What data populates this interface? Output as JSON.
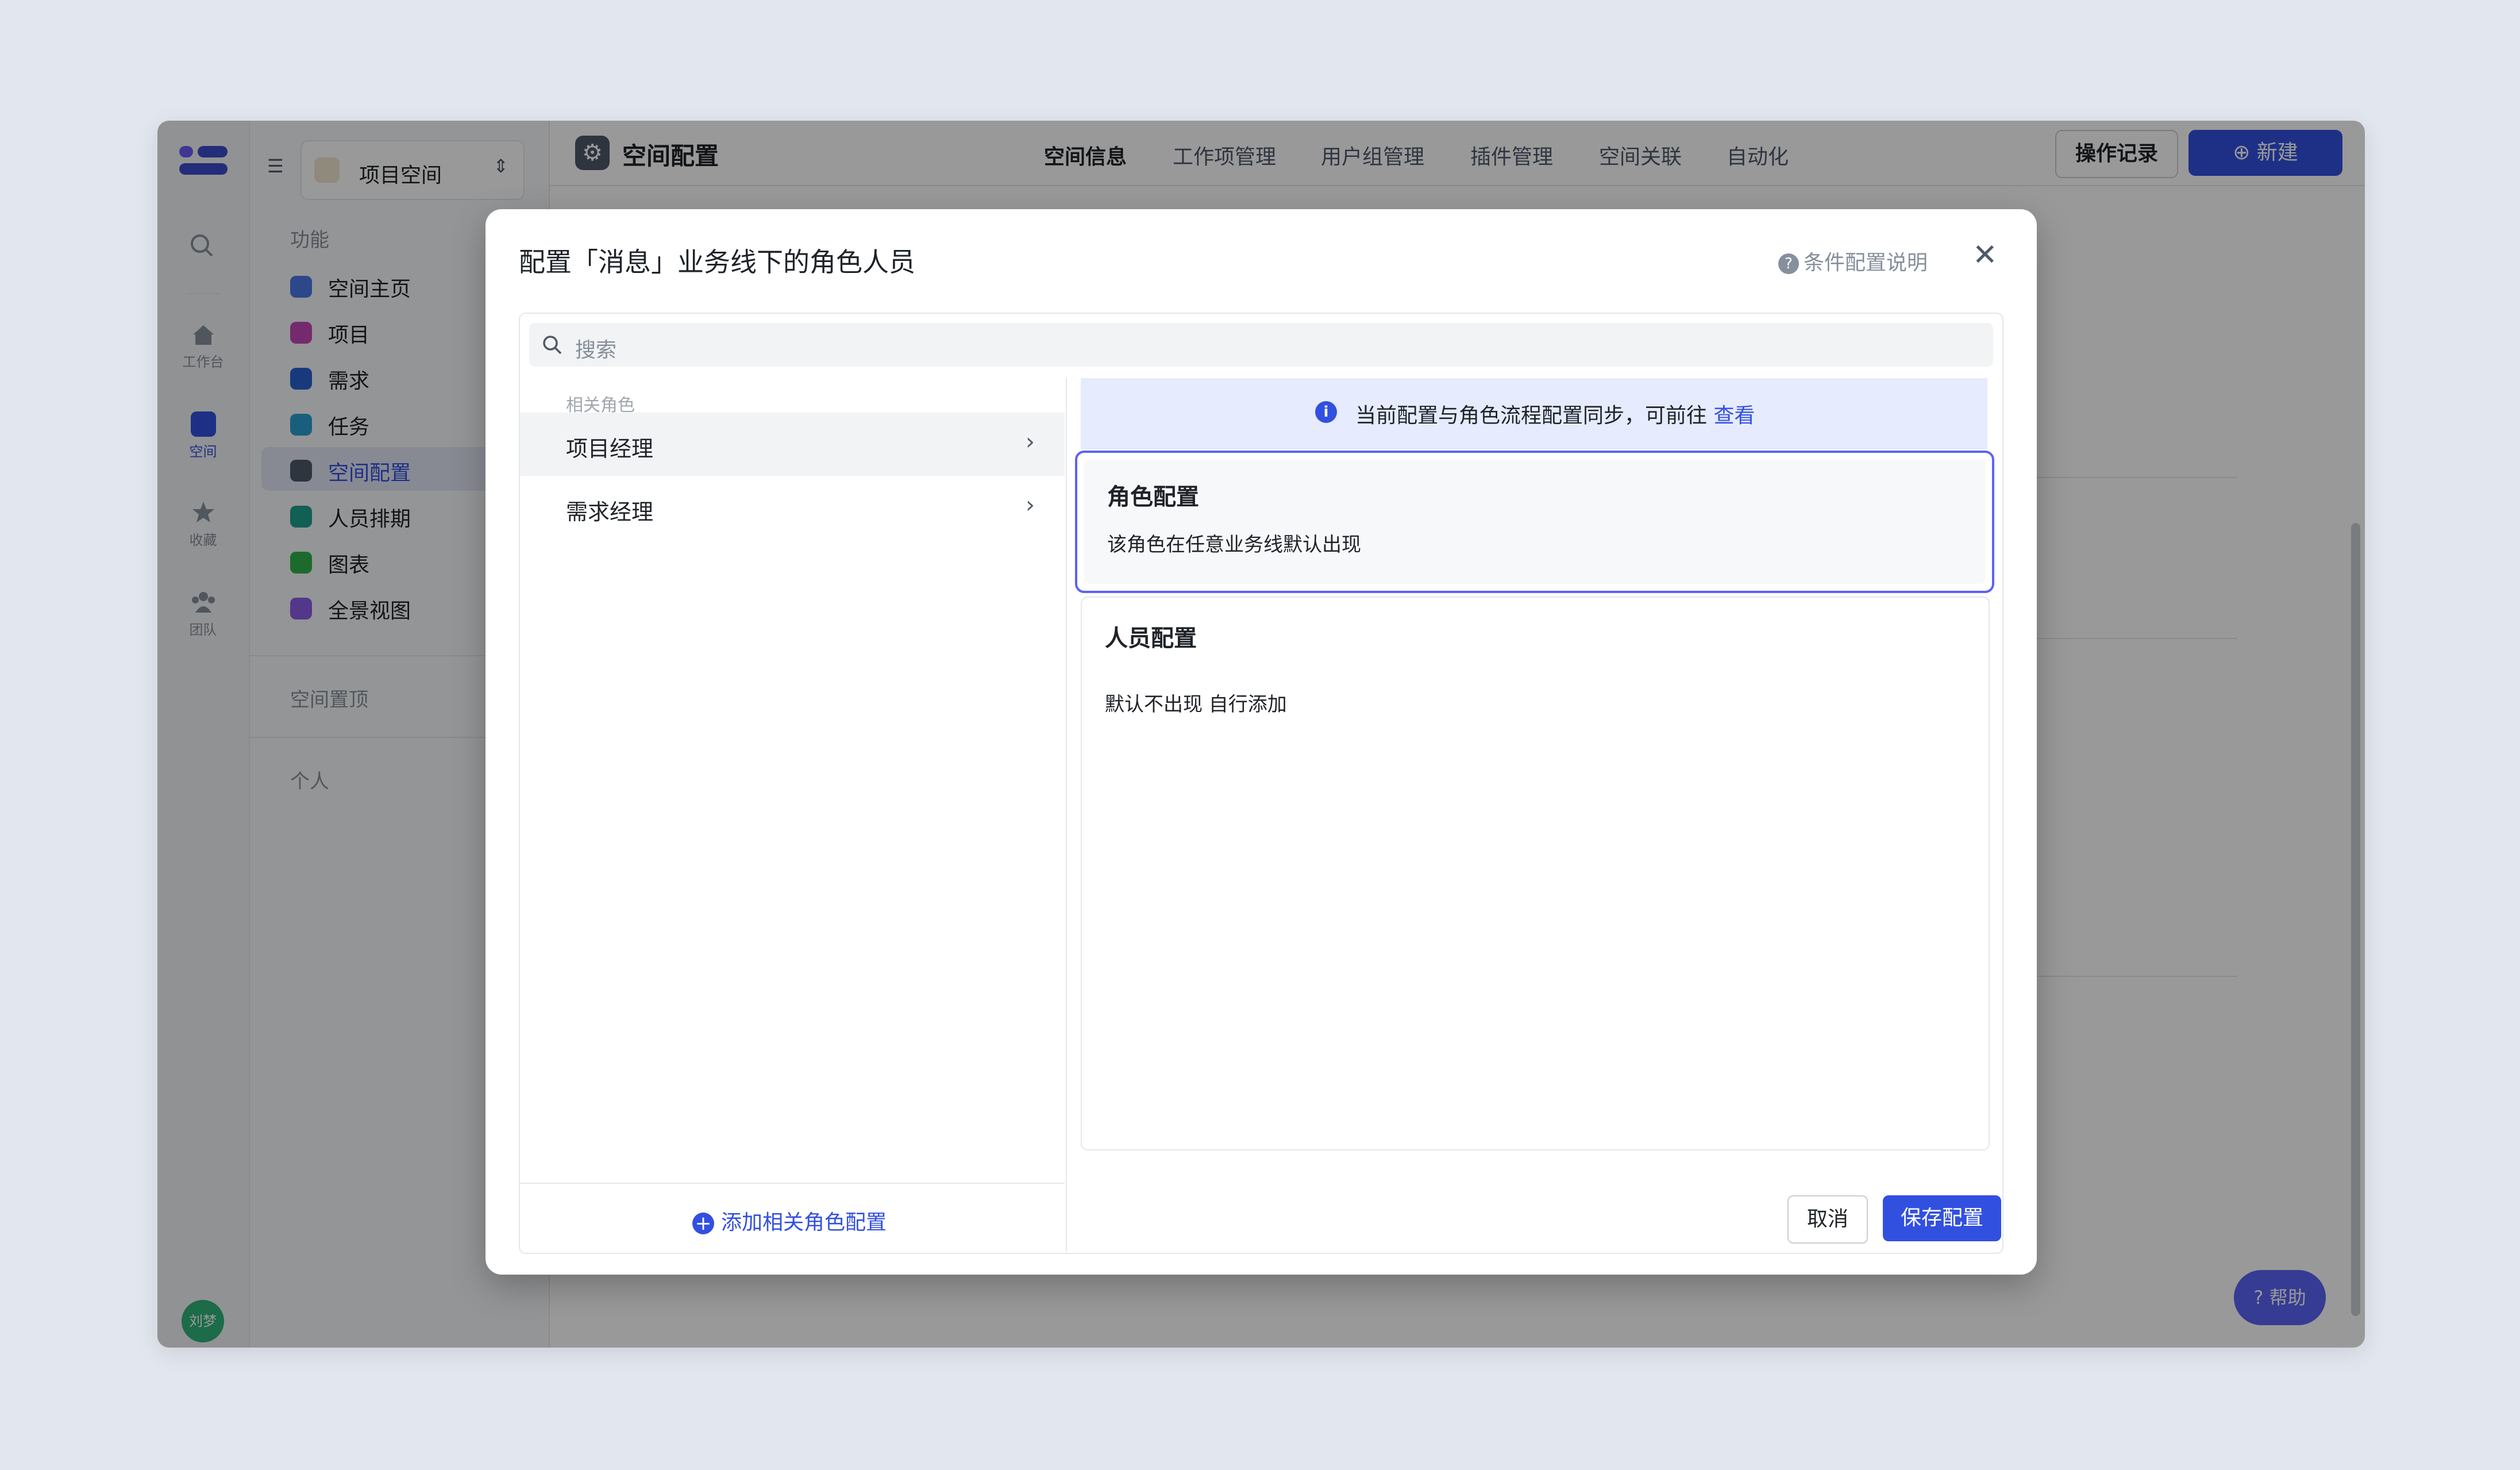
{
  "sidebar_rail": {
    "items": [
      {
        "label": "工作台",
        "icon": "home-icon"
      },
      {
        "label": "空间",
        "icon": "space-icon"
      },
      {
        "label": "收藏",
        "icon": "star-icon"
      },
      {
        "label": "团队",
        "icon": "team-icon"
      }
    ],
    "avatar": "刘梦"
  },
  "sidebar": {
    "workspace": "项目空间",
    "section_features": "功能",
    "items": [
      {
        "label": "空间主页",
        "color": "#4a78e8"
      },
      {
        "label": "项目",
        "color": "#c447b8"
      },
      {
        "label": "需求",
        "color": "#2b5fd1"
      },
      {
        "label": "任务",
        "color": "#2b9ed1"
      },
      {
        "label": "空间配置",
        "color": "#4e5969"
      },
      {
        "label": "人员排期",
        "color": "#1f9e8a"
      },
      {
        "label": "图表",
        "color": "#2fb34a"
      },
      {
        "label": "全景视图",
        "color": "#8a5ce8"
      }
    ],
    "section_pinned": "空间置顶",
    "section_personal": "个人"
  },
  "header": {
    "title": "空间配置",
    "tabs": [
      "空间信息",
      "工作项管理",
      "用户组管理",
      "插件管理",
      "空间关联",
      "自动化"
    ],
    "log_button": "操作记录",
    "new_button": "新建"
  },
  "help_button": "帮助",
  "modal": {
    "title": "配置「消息」业务线下的角色人员",
    "help_link": "条件配置说明",
    "search_placeholder": "搜索",
    "related_roles_label": "相关角色",
    "roles": [
      "项目经理",
      "需求经理"
    ],
    "add_role": "添加相关角色配置",
    "banner_text": "当前配置与角色流程配置同步，可前往",
    "banner_link": "查看",
    "role_config_title": "角色配置",
    "role_config_desc": "该角色在任意业务线默认出现",
    "people_config_title": "人员配置",
    "people_config_desc": "默认不出现 自行添加",
    "cancel": "取消",
    "save": "保存配置"
  },
  "colors": {
    "accent": "#3250e0",
    "selected_border": "#5b63f5"
  }
}
